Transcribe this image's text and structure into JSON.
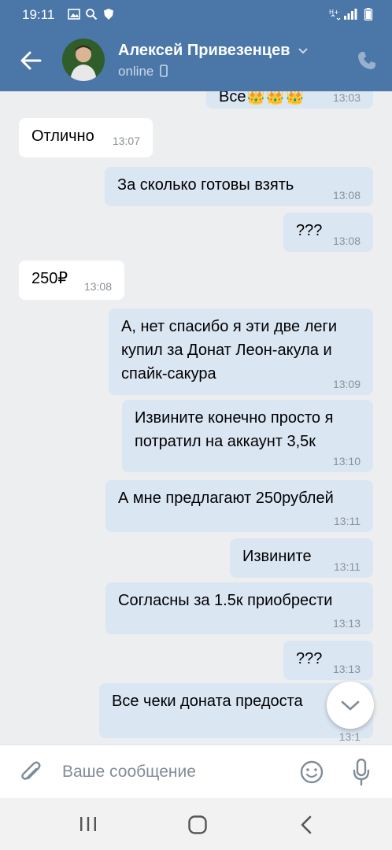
{
  "status_bar": {
    "time": "19:11"
  },
  "header": {
    "contact_name": "Алексей Привезенцев",
    "status": "online"
  },
  "messages": [
    {
      "text": "Все👑👑👑",
      "time": "13:03"
    },
    {
      "text": "Отлично",
      "time": "13:07"
    },
    {
      "text": "За сколько готовы взять",
      "time": "13:08"
    },
    {
      "text": "???",
      "time": "13:08"
    },
    {
      "text": "250₽",
      "time": "13:08"
    },
    {
      "text": "А, нет спасибо я эти две леги купил за Донат Леон-акула и спайк-сакура",
      "time": "13:09"
    },
    {
      "text": "Извините конечно просто я потратил на аккаунт 3,5к",
      "time": "13:10"
    },
    {
      "text": "А мне предлагают 250рублей",
      "time": "13:11"
    },
    {
      "text": "Извините",
      "time": "13:11"
    },
    {
      "text": "Согласны за 1.5к приобрести",
      "time": "13:13"
    },
    {
      "text": "???",
      "time": "13:13"
    },
    {
      "text": "Все чеки доната предоста",
      "time": "13:1"
    }
  ],
  "input": {
    "placeholder": "Ваше сообщение"
  },
  "icons": {
    "back": "arrow-left-icon",
    "phone": "phone-icon",
    "attach": "paperclip-icon",
    "emoji": "smile-icon",
    "mic": "microphone-icon",
    "scroll_down": "chevron-down-icon",
    "nav_recent": "recent-apps-icon",
    "nav_home": "home-icon",
    "nav_back": "back-icon"
  },
  "colors": {
    "header": "#4a76a8",
    "outgoing": "#dbe6f3",
    "incoming": "#ffffff",
    "background": "#edeef0"
  }
}
